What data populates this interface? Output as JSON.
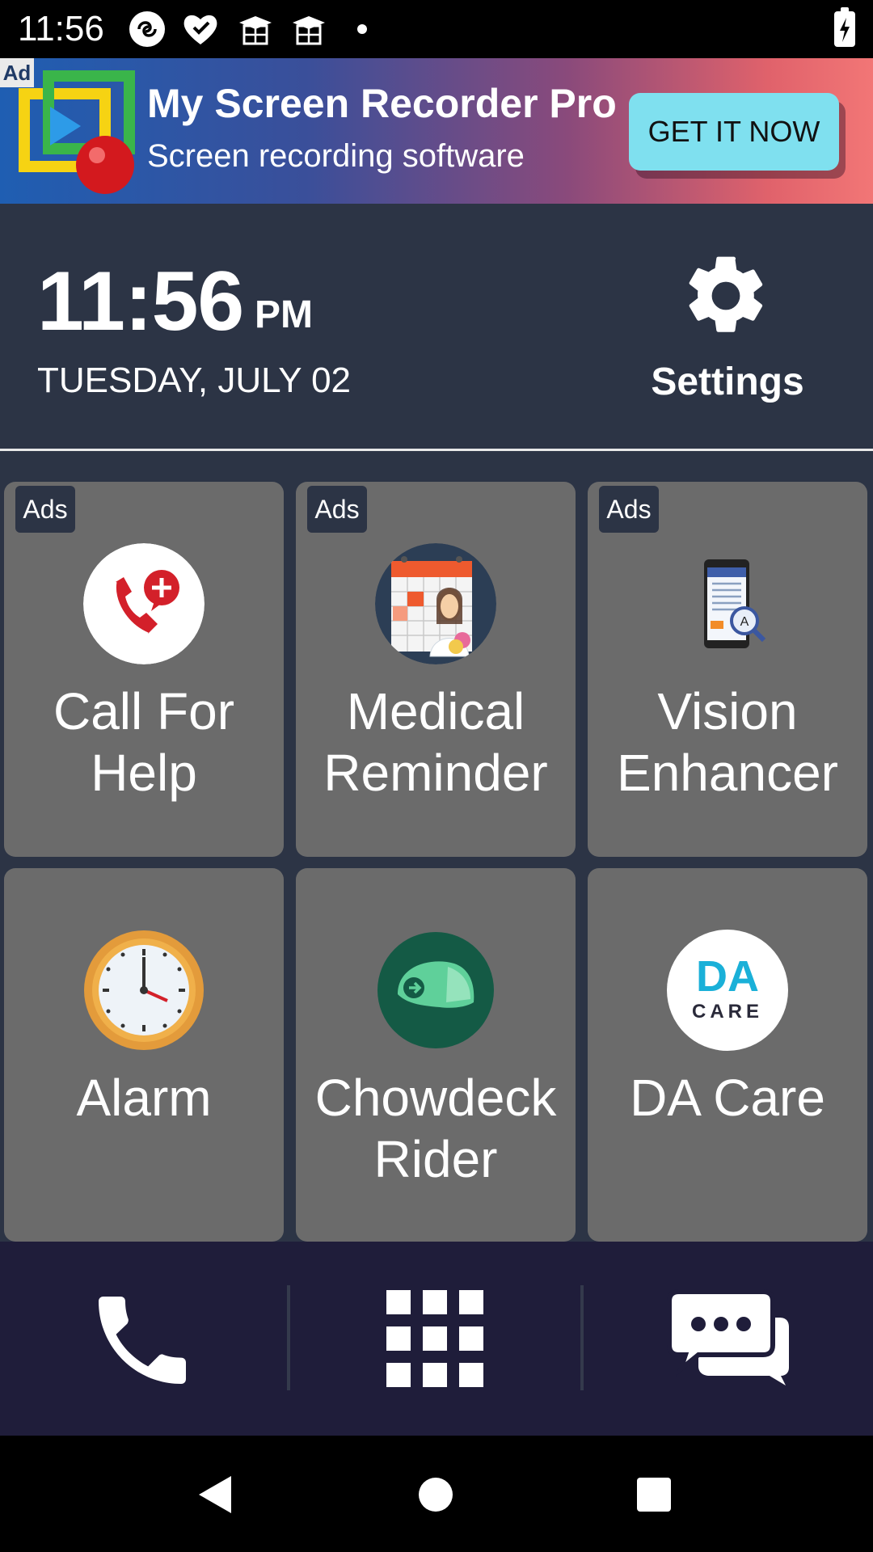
{
  "status_bar": {
    "time": "11:56",
    "icons": [
      "openai-app-icon",
      "heart-check-icon",
      "graduation-cap-icon",
      "graduation-cap-icon",
      "dot-icon"
    ],
    "battery": "battery-charging-icon"
  },
  "ad_banner": {
    "tag": "Ad",
    "title": "My Screen Recorder Pro",
    "subtitle": "Screen recording software",
    "cta": "GET IT NOW",
    "cta_color": "#7fe0ef"
  },
  "header": {
    "time": "11:56",
    "ampm": "PM",
    "date": "TUESDAY, JULY 02",
    "settings_label": "Settings"
  },
  "tiles": [
    {
      "label_line1": "Call For",
      "label_line2": "Help",
      "badge": "Ads",
      "icon": "call-for-help-icon"
    },
    {
      "label_line1": "Medical",
      "label_line2": "Reminder",
      "badge": "Ads",
      "icon": "medical-reminder-icon"
    },
    {
      "label_line1": "Vision",
      "label_line2": "Enhancer",
      "badge": "Ads",
      "icon": "vision-enhancer-icon"
    },
    {
      "label_line1": "Alarm",
      "label_line2": "",
      "badge": "",
      "icon": "alarm-clock-icon"
    },
    {
      "label_line1": "Chowdeck",
      "label_line2": "Rider",
      "badge": "",
      "icon": "chowdeck-helmet-icon"
    },
    {
      "label_line1": "DA Care",
      "label_line2": "",
      "badge": "",
      "icon": "da-care-logo-icon"
    }
  ],
  "da_care_logo": {
    "top": "DA",
    "bottom": "CARE"
  },
  "bottom_nav": {
    "items": [
      "phone-icon",
      "apps-grid-icon",
      "messages-icon"
    ]
  },
  "system_nav": {
    "items": [
      "back-icon",
      "home-icon",
      "recents-icon"
    ]
  },
  "colors": {
    "background": "#2c3445",
    "tile": "#6b6b6b",
    "nav": "#1f1d3a"
  }
}
